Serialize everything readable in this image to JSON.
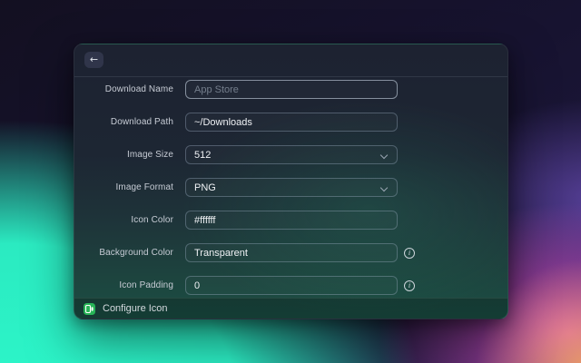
{
  "window": {
    "header": {
      "back_icon": "←"
    },
    "footer": {
      "label": "Configure Icon"
    }
  },
  "form": {
    "rows": [
      {
        "label": "Download Name",
        "type": "input",
        "value": "",
        "placeholder": "App Store"
      },
      {
        "label": "Download Path",
        "type": "input",
        "value": "~/Downloads"
      },
      {
        "label": "Image Size",
        "type": "select",
        "value": "512"
      },
      {
        "label": "Image Format",
        "type": "select",
        "value": "PNG"
      },
      {
        "label": "Icon Color",
        "type": "input",
        "value": "#ffffff"
      },
      {
        "label": "Background Color",
        "type": "input",
        "value": "Transparent",
        "info": true
      },
      {
        "label": "Icon Padding",
        "type": "input",
        "value": "0",
        "info": true
      }
    ]
  },
  "icons": {
    "back": "←",
    "chevron_down": "chevron-down",
    "info_glyph": "i",
    "app_logo": "green-app-logo"
  },
  "colors": {
    "logo_green": "#27b457",
    "bg_teal": "#2cf6c9",
    "bg_pink": "#eb55d7",
    "bg_purple": "#7d5ad7",
    "bg_orange": "#f0a660",
    "dialog_top": "#1d2231",
    "dialog_bottom": "#1b4f44"
  }
}
